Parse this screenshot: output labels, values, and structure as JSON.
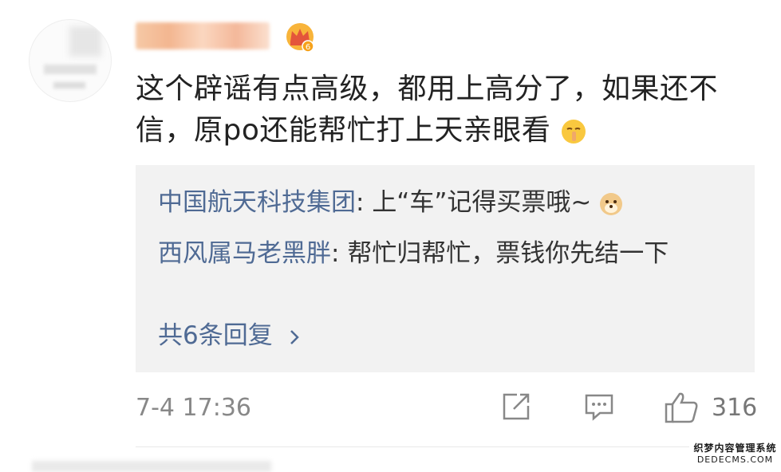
{
  "comment": {
    "text": "这个辟谣有点高级，都用上高分了，如果还不信，原po还能帮忙打上天亲眼看",
    "badge_level": "6",
    "time": "7-4 17:36",
    "like_count": "316"
  },
  "replies": [
    {
      "author": "中国航天科技集团",
      "sep": ": ",
      "text": "上“车”记得买票哦~"
    },
    {
      "author": "西风属马老黑胖",
      "sep": ": ",
      "text": "帮忙归帮忙，票钱你先结一下"
    }
  ],
  "more_replies": "共6条回复",
  "icons": {
    "crown": "crown-badge-icon",
    "shush": "shush-emoji-icon",
    "dog": "doge-emoji-icon",
    "share": "share-icon",
    "comment": "comment-icon",
    "like": "thumbs-up-icon",
    "chevron": "chevron-right-icon"
  },
  "colors": {
    "author": "#4f6a94",
    "reply_bg": "#f2f2f2",
    "meta": "#888888"
  },
  "watermark": {
    "line1": "织梦内容管理系统",
    "line2": "DEDECMS.COM"
  }
}
